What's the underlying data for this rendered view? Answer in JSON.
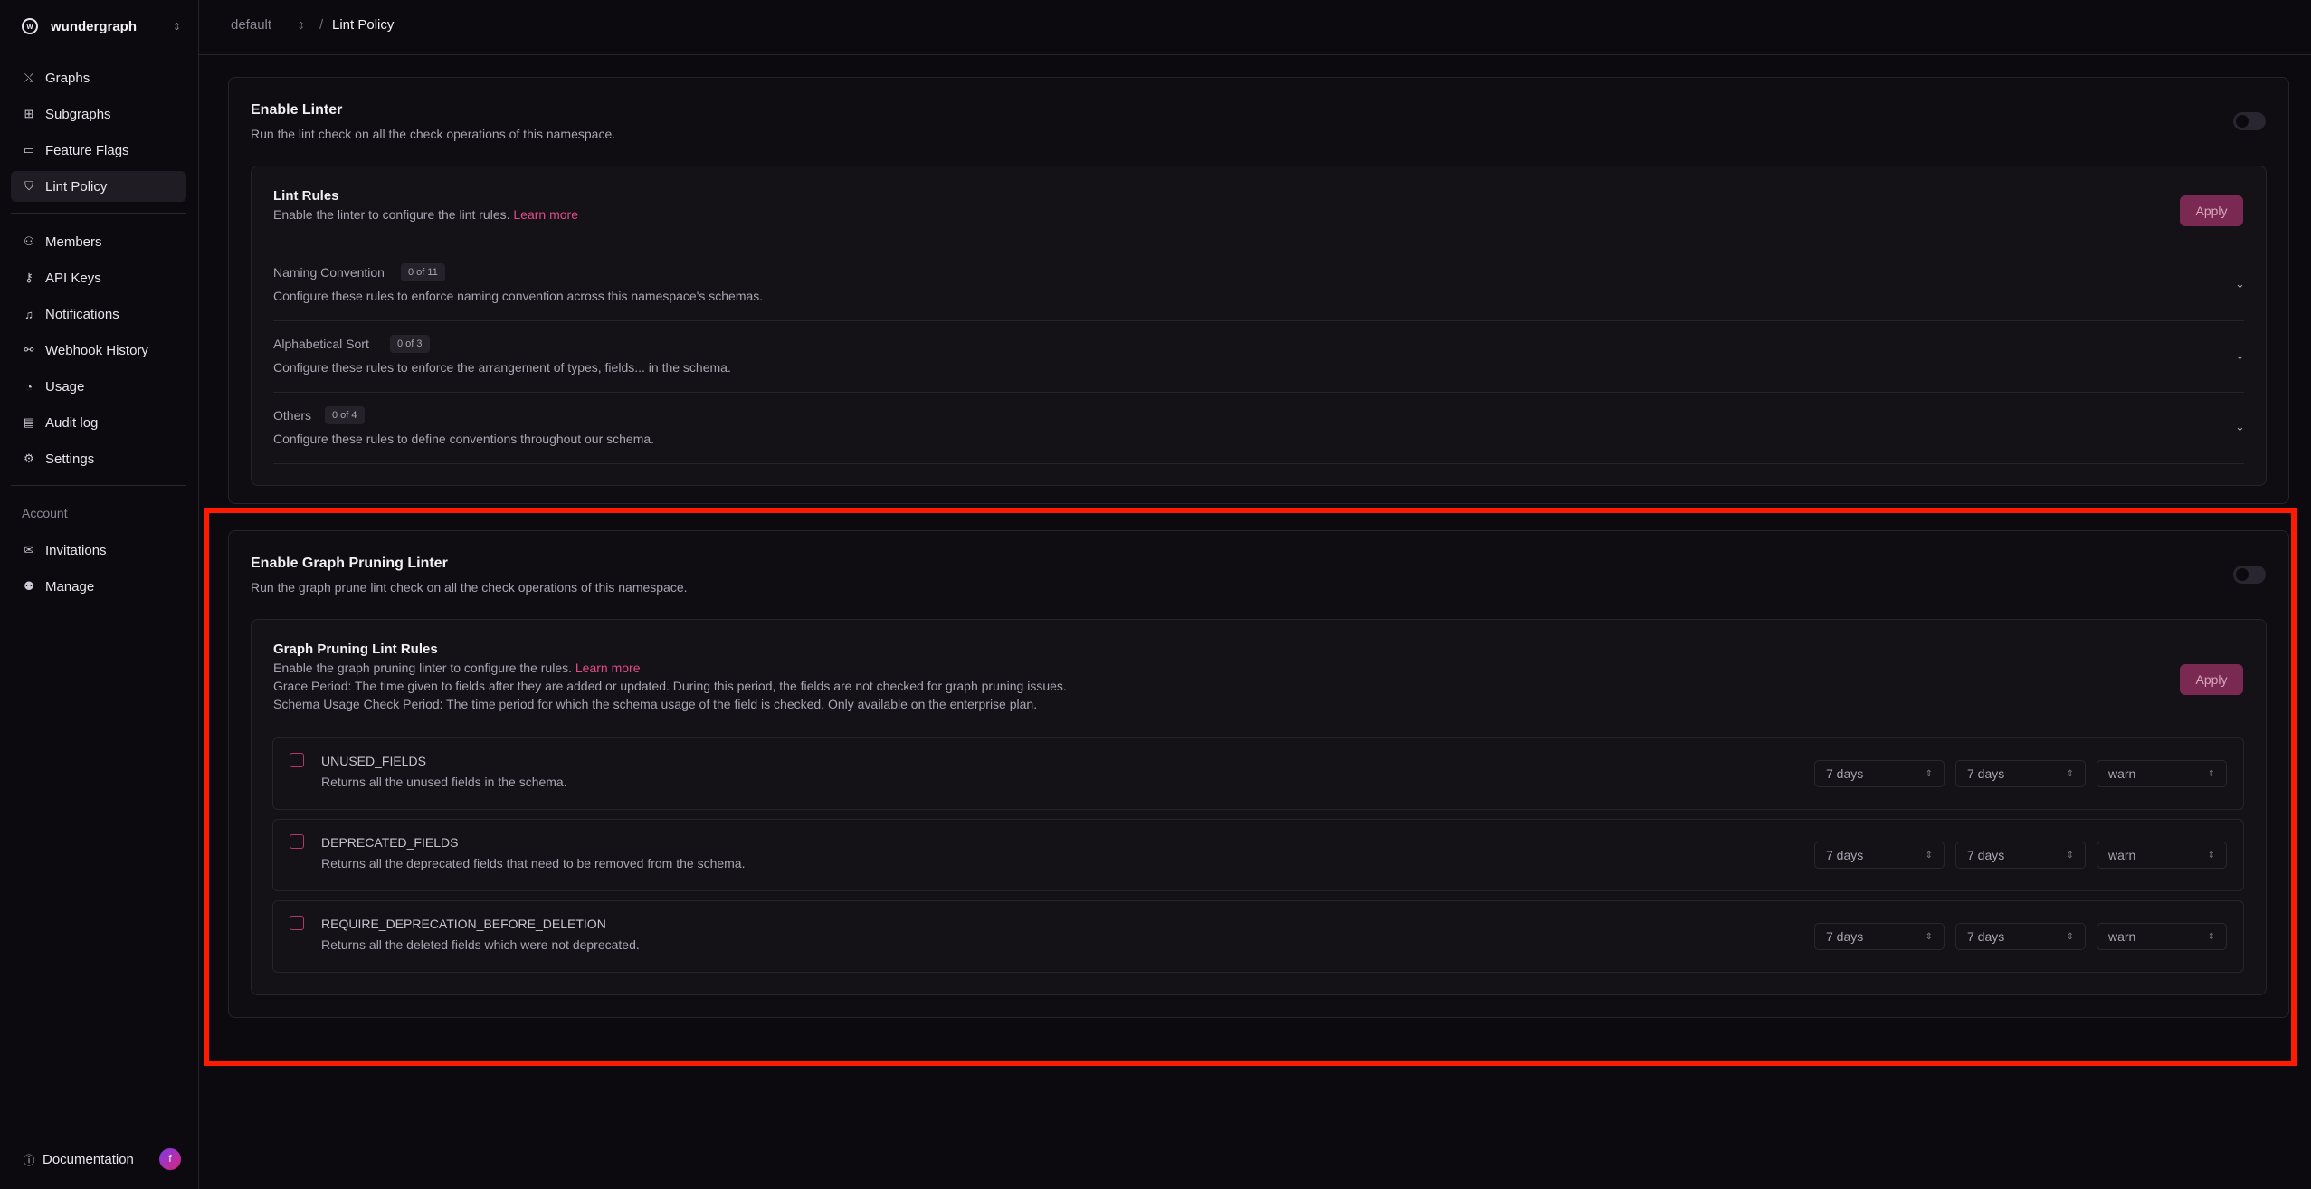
{
  "org": {
    "name": "wundergraph"
  },
  "nav": {
    "graphs": "Graphs",
    "subgraphs": "Subgraphs",
    "feature_flags": "Feature Flags",
    "lint_policy": "Lint Policy",
    "members": "Members",
    "api_keys": "API Keys",
    "notifications": "Notifications",
    "webhook_history": "Webhook History",
    "usage": "Usage",
    "audit_log": "Audit log",
    "settings": "Settings",
    "account_label": "Account",
    "invitations": "Invitations",
    "manage": "Manage",
    "documentation": "Documentation",
    "avatar_initial": "f"
  },
  "breadcrumb": {
    "namespace": "default",
    "separator": "/",
    "page": "Lint Policy"
  },
  "linter": {
    "title": "Enable Linter",
    "description": "Run the lint check on all the check operations of this namespace.",
    "rules_title": "Lint Rules",
    "rules_desc": "Enable the linter to configure the lint rules.",
    "learn_more": "Learn more",
    "apply": "Apply",
    "groups": [
      {
        "name": "Naming Convention",
        "badge": "0 of 11",
        "desc": "Configure these rules to enforce naming convention across this namespace's schemas."
      },
      {
        "name": "Alphabetical Sort",
        "badge": "0 of 3",
        "desc": "Configure these rules to enforce the arrangement of types, fields... in the schema."
      },
      {
        "name": "Others",
        "badge": "0 of 4",
        "desc": "Configure these rules to define conventions throughout our schema."
      }
    ]
  },
  "pruning": {
    "title": "Enable Graph Pruning Linter",
    "description": "Run the graph prune lint check on all the check operations of this namespace.",
    "rules_title": "Graph Pruning Lint Rules",
    "rules_desc": "Enable the graph pruning linter to configure the rules.",
    "learn_more": "Learn more",
    "grace_period": "Grace Period: The time given to fields after they are added or updated. During this period, the fields are not checked for graph pruning issues.",
    "usage_period": "Schema Usage Check Period: The time period for which the schema usage of the field is checked. Only available on the enterprise plan.",
    "apply": "Apply",
    "rules": [
      {
        "name": "UNUSED_FIELDS",
        "desc": "Returns all the unused fields in the schema.",
        "grace": "7 days",
        "usage": "7 days",
        "severity": "warn"
      },
      {
        "name": "DEPRECATED_FIELDS",
        "desc": "Returns all the deprecated fields that need to be removed from the schema.",
        "grace": "7 days",
        "usage": "7 days",
        "severity": "warn"
      },
      {
        "name": "REQUIRE_DEPRECATION_BEFORE_DELETION",
        "desc": "Returns all the deleted fields which were not deprecated.",
        "grace": "7 days",
        "usage": "7 days",
        "severity": "warn"
      }
    ]
  },
  "colors": {
    "accent": "#e04b8a",
    "apply_bg": "#7a2a52",
    "highlight": "#ff1a00",
    "background": "#0c090f"
  }
}
